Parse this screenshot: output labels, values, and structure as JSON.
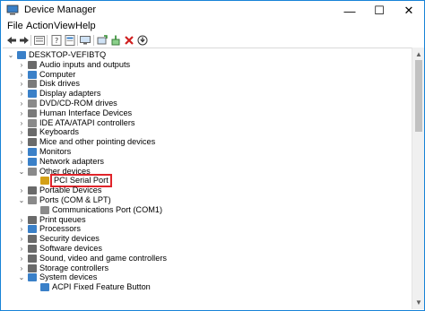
{
  "window": {
    "title": "Device Manager"
  },
  "titlebar_buttons": {
    "minimize": "—",
    "maximize": "☐",
    "close": "✕"
  },
  "menu": [
    "File",
    "Action",
    "View",
    "Help"
  ],
  "toolbar": [
    "back-arrow-icon",
    "forward-arrow-icon",
    "properties-icon",
    "help-icon",
    "view-icon",
    "scan-icon",
    "uninstall-icon",
    "update-driver-icon"
  ],
  "tree": {
    "root": "DESKTOP-VEFIBTQ",
    "items": [
      {
        "label": "Audio inputs and outputs",
        "color": "#6a6a6a"
      },
      {
        "label": "Computer",
        "color": "#3a80c8"
      },
      {
        "label": "Disk drives",
        "color": "#7a7a7a"
      },
      {
        "label": "Display adapters",
        "color": "#3a80c8"
      },
      {
        "label": "DVD/CD-ROM drives",
        "color": "#8a8a8a"
      },
      {
        "label": "Human Interface Devices",
        "color": "#7a7a7a"
      },
      {
        "label": "IDE ATA/ATAPI controllers",
        "color": "#8a8a8a"
      },
      {
        "label": "Keyboards",
        "color": "#6a6a6a"
      },
      {
        "label": "Mice and other pointing devices",
        "color": "#6a6a6a"
      },
      {
        "label": "Monitors",
        "color": "#3a80c8"
      },
      {
        "label": "Network adapters",
        "color": "#3a80c8"
      },
      {
        "label": "Other devices",
        "color": "#8a8a8a",
        "expanded": true
      },
      {
        "label": "PCI Serial Port",
        "color": "#d4a017",
        "child": true,
        "highlight": true
      },
      {
        "label": "Portable Devices",
        "color": "#6a6a6a"
      },
      {
        "label": "Ports (COM & LPT)",
        "color": "#8a8a8a",
        "expanded": true
      },
      {
        "label": "Communications Port (COM1)",
        "color": "#8a8a8a",
        "child": true
      },
      {
        "label": "Print queues",
        "color": "#6a6a6a"
      },
      {
        "label": "Processors",
        "color": "#3a80c8"
      },
      {
        "label": "Security devices",
        "color": "#6a6a6a"
      },
      {
        "label": "Software devices",
        "color": "#6a6a6a"
      },
      {
        "label": "Sound, video and game controllers",
        "color": "#6a6a6a"
      },
      {
        "label": "Storage controllers",
        "color": "#6a6a6a"
      },
      {
        "label": "System devices",
        "color": "#3a80c8",
        "expanded": true
      },
      {
        "label": "ACPI Fixed Feature Button",
        "color": "#3a80c8",
        "child": true
      }
    ]
  }
}
